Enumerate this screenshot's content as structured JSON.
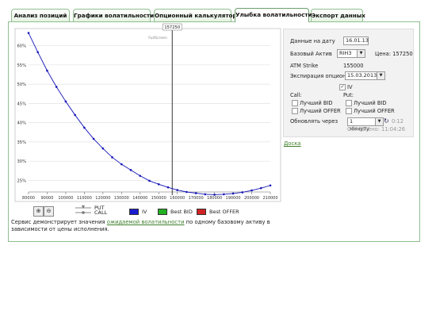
{
  "tabs": [
    {
      "label": "Анализ позиций"
    },
    {
      "label": "Графики волатильности"
    },
    {
      "label": "Опционный калькулятор"
    },
    {
      "label": "Улыбка волатильности"
    },
    {
      "label": "Экспорт данных"
    }
  ],
  "chart": {
    "fullscreen_label": "FullScreen",
    "atm_marker": "157250"
  },
  "chart_data": {
    "type": "line",
    "x_ticks": [
      "80000",
      "90000",
      "100000",
      "110000",
      "120000",
      "130000",
      "140000",
      "150000",
      "160000",
      "170000",
      "180000",
      "190000",
      "200000",
      "210000"
    ],
    "y_ticks": [
      "25%",
      "30%",
      "35%",
      "40%",
      "45%",
      "50%",
      "55%",
      "60%"
    ],
    "xlim": [
      80000,
      210000
    ],
    "ylim": [
      0.22,
      0.63
    ],
    "atm_x": 157250,
    "series": [
      {
        "name": "IV",
        "color": "#1515b8",
        "x": [
          80000,
          85000,
          90000,
          95000,
          100000,
          105000,
          110000,
          115000,
          120000,
          125000,
          130000,
          135000,
          140000,
          145000,
          150000,
          155000,
          160000,
          165000,
          170000,
          175000,
          180000,
          185000,
          190000,
          195000,
          200000,
          205000,
          210000
        ],
        "y": [
          0.633,
          0.583,
          0.535,
          0.493,
          0.455,
          0.42,
          0.387,
          0.358,
          0.333,
          0.31,
          0.292,
          0.277,
          0.262,
          0.249,
          0.24,
          0.232,
          0.225,
          0.22,
          0.217,
          0.214,
          0.213,
          0.214,
          0.216,
          0.219,
          0.224,
          0.23,
          0.237
        ]
      }
    ],
    "legend": [
      {
        "label": "PUT"
      },
      {
        "label": "CALL"
      },
      {
        "label": "IV",
        "color": "#1a1ad0"
      },
      {
        "label": "Best BID",
        "color": "#22b022"
      },
      {
        "label": "Best OFFER",
        "color": "#d02222"
      }
    ]
  },
  "description": {
    "before": "Сервис демонстрирует значения ",
    "link": "ожидаемой волатильности",
    "after": " по одному базовому активу в зависимости от цены исполнения."
  },
  "controls": {
    "date_label": "Данные на дату",
    "date_value": "16.01.13",
    "base_label": "Базовый Актив",
    "base_value": "RIH3",
    "price_label": "Цена: 157250",
    "atm_label": "ATM Strike",
    "atm_value": "155000",
    "expiry_label": "Экспирация опционов",
    "expiry_value": "15.03.2013",
    "iv_label": "IV",
    "call_label": "Call:",
    "put_label": "Put:",
    "best_bid": "Лучший BID",
    "best_offer": "Лучший OFFER",
    "refresh_label": "Обновлять через",
    "refresh_value": "1 минуту",
    "timer": "0:12",
    "updated": "Обновлено: 11:04:26"
  },
  "board_link": "Доска"
}
